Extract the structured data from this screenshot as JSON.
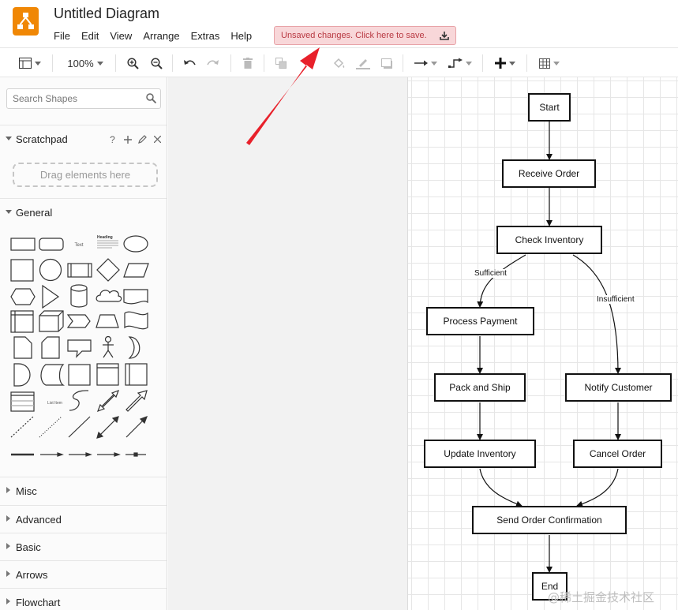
{
  "app": {
    "title": "Untitled Diagram",
    "menus": [
      "File",
      "Edit",
      "View",
      "Arrange",
      "Extras",
      "Help"
    ],
    "unsaved_notice": "Unsaved changes. Click here to save.",
    "accent_color": "#f08705"
  },
  "toolbar": {
    "zoom": "100%",
    "icons": [
      "format-panel-icon",
      "zoom-in-icon",
      "zoom-out-icon",
      "undo-icon",
      "redo-icon",
      "delete-icon",
      "to-front-icon",
      "fill-color-icon",
      "line-color-icon",
      "shadow-icon",
      "connection-icon",
      "waypoints-icon",
      "insert-icon",
      "table-icon"
    ]
  },
  "sidebar": {
    "search_placeholder": "Search Shapes",
    "scratchpad": {
      "label": "Scratchpad",
      "help": "?",
      "drop_hint": "Drag elements here"
    },
    "sections": [
      "General",
      "Misc",
      "Advanced",
      "Basic",
      "Arrows",
      "Flowchart"
    ],
    "shape_text": {
      "text_label": "Text",
      "heading_label": "Heading",
      "list_label": "List Item"
    }
  },
  "diagram": {
    "nodes": {
      "start": "Start",
      "receive": "Receive Order",
      "check": "Check Inventory",
      "payment": "Process Payment",
      "ship": "Pack and Ship",
      "update": "Update Inventory",
      "notify": "Notify Customer",
      "cancel": "Cancel Order",
      "confirm": "Send Order Confirmation",
      "end": "End"
    },
    "edge_labels": {
      "sufficient": "Sufficient",
      "insufficient": "Insufficient"
    }
  },
  "watermark": "@稀土掘金技术社区"
}
